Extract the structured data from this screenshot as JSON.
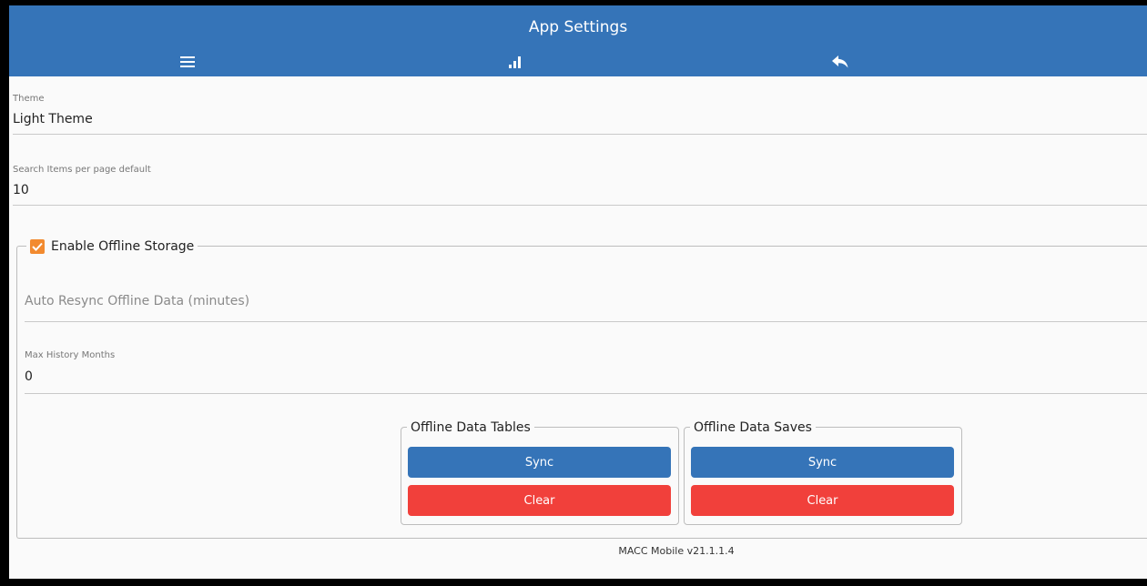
{
  "header": {
    "title": "App Settings",
    "icons": [
      "hamburger-menu-icon",
      "signal-bars-icon",
      "reply-back-icon"
    ]
  },
  "theme": {
    "label": "Theme",
    "value": "Light Theme"
  },
  "search_items": {
    "label": "Search Items per page default",
    "value": "10"
  },
  "offline": {
    "label": "Enable Offline Storage",
    "checked": true,
    "resync_placeholder": "Auto Resync Offline Data (minutes)",
    "history": {
      "label": "Max History Months",
      "value": "0"
    },
    "tables": {
      "legend": "Offline Data Tables",
      "sync_label": "Sync",
      "clear_label": "Clear"
    },
    "saves": {
      "legend": "Offline Data Saves",
      "sync_label": "Sync",
      "clear_label": "Clear"
    }
  },
  "footer": {
    "version": "MACC Mobile v21.1.1.4"
  },
  "colors": {
    "primary": "#3574b8",
    "danger": "#f1403b",
    "accent": "#f28a2f"
  }
}
